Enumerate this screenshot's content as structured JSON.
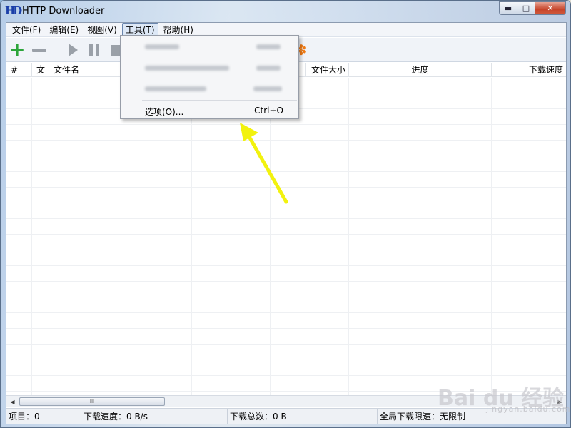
{
  "window": {
    "title": "HTTP Downloader",
    "icon_text": "HD"
  },
  "window_controls": {
    "minimize": "▬",
    "maximize": "□",
    "close": "✕"
  },
  "menubar": {
    "items": [
      {
        "label": "文件(F)"
      },
      {
        "label": "编辑(E)"
      },
      {
        "label": "视图(V)"
      },
      {
        "label": "工具(T)",
        "active": true
      },
      {
        "label": "帮助(H)"
      }
    ]
  },
  "toolbar": {
    "buttons": [
      {
        "name": "add-button",
        "icon": "plus-icon",
        "glyph": "+"
      },
      {
        "name": "remove-button",
        "icon": "minus-icon"
      },
      {
        "name": "start-button",
        "icon": "play-icon"
      },
      {
        "name": "pause-button",
        "icon": "pause-icon"
      },
      {
        "name": "stop-button",
        "icon": "stop-icon"
      },
      {
        "name": "options-button",
        "icon": "gear-icon",
        "glyph": "✽"
      }
    ]
  },
  "table": {
    "columns": [
      "#",
      "文",
      "文件名",
      "",
      "",
      "文件大小",
      "进度",
      "下载速度"
    ]
  },
  "scrollbar": {
    "left_arrow": "◀",
    "right_arrow": "▶",
    "grip": "III"
  },
  "statusbar": {
    "items": "项目：0",
    "speed": "下载速度：0 B/s",
    "total": "下载总数：0 B",
    "limit": "全局下载限速：无限制"
  },
  "tools_menu": {
    "options": {
      "label": "选项(O)...",
      "shortcut": "Ctrl+O"
    }
  },
  "annotation": {
    "arrow_color": "#f2f20e"
  },
  "watermark": {
    "text": "Bai du 经验",
    "sub": "jingyan.baidu.com"
  }
}
